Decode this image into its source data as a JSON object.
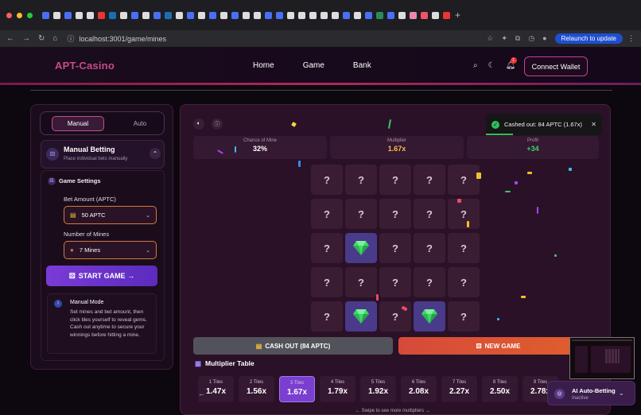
{
  "browser": {
    "url": "localhost:3001/game/mines",
    "relaunch_label": "Relaunch to update"
  },
  "header": {
    "logo": "APT-Casino",
    "nav": [
      "Home",
      "Game",
      "Bank"
    ],
    "notification_count": "1",
    "connect_label": "Connect Wallet"
  },
  "mode_tabs": {
    "manual": "Manual",
    "auto": "Auto"
  },
  "manual_betting": {
    "title": "Manual Betting",
    "subtitle": "Place individual bets manually"
  },
  "game_settings": {
    "title": "Game Settings",
    "bet_label": "Bet Amount (APTC)",
    "bet_value": "50 APTC",
    "mines_label": "Number of Mines",
    "mines_value": "7 Mines",
    "start_label": "START GAME →"
  },
  "manual_mode_info": {
    "title": "Manual Mode",
    "text": "Set mines and bet amount, then click tiles yourself to reveal gems. Cash out anytime to secure your winnings before hitting a mine."
  },
  "stats": {
    "chance_label": "Chance of Mine",
    "chance_value": "32%",
    "multiplier_label": "Multiplier",
    "multiplier_value": "1.67x",
    "profit_label": "Profit",
    "profit_value": "+34"
  },
  "board": [
    [
      "?",
      "?",
      "?",
      "?",
      "?"
    ],
    [
      "?",
      "?",
      "?",
      "?",
      "?"
    ],
    [
      "?",
      "gem",
      "?",
      "?",
      "?"
    ],
    [
      "?",
      "?",
      "?",
      "?",
      "?"
    ],
    [
      "?",
      "gem",
      "?",
      "gem",
      "?"
    ]
  ],
  "actions": {
    "cashout_label": "CASH OUT (84 APTC)",
    "newgame_label": "NEW GAME"
  },
  "multiplier_table": {
    "title": "Multiplier Table",
    "items": [
      {
        "label": "1 Tiles",
        "value": "1.47x"
      },
      {
        "label": "2 Tiles",
        "value": "1.56x"
      },
      {
        "label": "3 Tiles",
        "value": "1.67x"
      },
      {
        "label": "4 Tiles",
        "value": "1.79x"
      },
      {
        "label": "5 Tiles",
        "value": "1.92x"
      },
      {
        "label": "6 Tiles",
        "value": "2.08x"
      },
      {
        "label": "7 Tiles",
        "value": "2.27x"
      },
      {
        "label": "8 Tiles",
        "value": "2.50x"
      },
      {
        "label": "9 Tiles",
        "value": "2.78x"
      }
    ],
    "selected_index": 2,
    "swipe_hint": "Swipe to see more multipliers"
  },
  "toast": {
    "message": "Cashed out: 84 APTC (1.67x)"
  },
  "ai_betting": {
    "title": "AI Auto-Betting",
    "status": "Inactive"
  },
  "colors": {
    "accent": "#c34c92",
    "purple": "#7a3ed0",
    "green": "#2fbf5a",
    "orange": "#e0602c",
    "gem": "#4a3a8a"
  }
}
